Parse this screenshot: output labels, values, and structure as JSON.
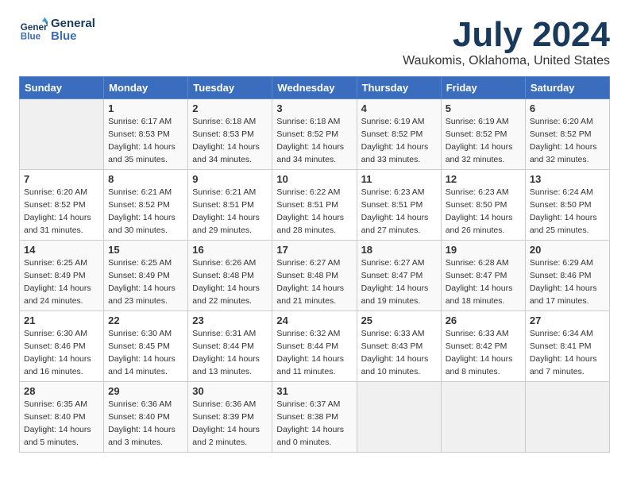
{
  "app": {
    "name": "GeneralBlue",
    "logo_color": "#1a3a5c"
  },
  "header": {
    "month_year": "July 2024",
    "location": "Waukomis, Oklahoma, United States"
  },
  "calendar": {
    "days_of_week": [
      "Sunday",
      "Monday",
      "Tuesday",
      "Wednesday",
      "Thursday",
      "Friday",
      "Saturday"
    ],
    "weeks": [
      [
        {
          "day": "",
          "empty": true
        },
        {
          "day": "1",
          "sunrise": "6:17 AM",
          "sunset": "8:53 PM",
          "daylight": "14 hours and 35 minutes."
        },
        {
          "day": "2",
          "sunrise": "6:18 AM",
          "sunset": "8:53 PM",
          "daylight": "14 hours and 34 minutes."
        },
        {
          "day": "3",
          "sunrise": "6:18 AM",
          "sunset": "8:52 PM",
          "daylight": "14 hours and 34 minutes."
        },
        {
          "day": "4",
          "sunrise": "6:19 AM",
          "sunset": "8:52 PM",
          "daylight": "14 hours and 33 minutes."
        },
        {
          "day": "5",
          "sunrise": "6:19 AM",
          "sunset": "8:52 PM",
          "daylight": "14 hours and 32 minutes."
        },
        {
          "day": "6",
          "sunrise": "6:20 AM",
          "sunset": "8:52 PM",
          "daylight": "14 hours and 32 minutes."
        }
      ],
      [
        {
          "day": "7",
          "sunrise": "6:20 AM",
          "sunset": "8:52 PM",
          "daylight": "14 hours and 31 minutes."
        },
        {
          "day": "8",
          "sunrise": "6:21 AM",
          "sunset": "8:52 PM",
          "daylight": "14 hours and 30 minutes."
        },
        {
          "day": "9",
          "sunrise": "6:21 AM",
          "sunset": "8:51 PM",
          "daylight": "14 hours and 29 minutes."
        },
        {
          "day": "10",
          "sunrise": "6:22 AM",
          "sunset": "8:51 PM",
          "daylight": "14 hours and 28 minutes."
        },
        {
          "day": "11",
          "sunrise": "6:23 AM",
          "sunset": "8:51 PM",
          "daylight": "14 hours and 27 minutes."
        },
        {
          "day": "12",
          "sunrise": "6:23 AM",
          "sunset": "8:50 PM",
          "daylight": "14 hours and 26 minutes."
        },
        {
          "day": "13",
          "sunrise": "6:24 AM",
          "sunset": "8:50 PM",
          "daylight": "14 hours and 25 minutes."
        }
      ],
      [
        {
          "day": "14",
          "sunrise": "6:25 AM",
          "sunset": "8:49 PM",
          "daylight": "14 hours and 24 minutes."
        },
        {
          "day": "15",
          "sunrise": "6:25 AM",
          "sunset": "8:49 PM",
          "daylight": "14 hours and 23 minutes."
        },
        {
          "day": "16",
          "sunrise": "6:26 AM",
          "sunset": "8:48 PM",
          "daylight": "14 hours and 22 minutes."
        },
        {
          "day": "17",
          "sunrise": "6:27 AM",
          "sunset": "8:48 PM",
          "daylight": "14 hours and 21 minutes."
        },
        {
          "day": "18",
          "sunrise": "6:27 AM",
          "sunset": "8:47 PM",
          "daylight": "14 hours and 19 minutes."
        },
        {
          "day": "19",
          "sunrise": "6:28 AM",
          "sunset": "8:47 PM",
          "daylight": "14 hours and 18 minutes."
        },
        {
          "day": "20",
          "sunrise": "6:29 AM",
          "sunset": "8:46 PM",
          "daylight": "14 hours and 17 minutes."
        }
      ],
      [
        {
          "day": "21",
          "sunrise": "6:30 AM",
          "sunset": "8:46 PM",
          "daylight": "14 hours and 16 minutes."
        },
        {
          "day": "22",
          "sunrise": "6:30 AM",
          "sunset": "8:45 PM",
          "daylight": "14 hours and 14 minutes."
        },
        {
          "day": "23",
          "sunrise": "6:31 AM",
          "sunset": "8:44 PM",
          "daylight": "14 hours and 13 minutes."
        },
        {
          "day": "24",
          "sunrise": "6:32 AM",
          "sunset": "8:44 PM",
          "daylight": "14 hours and 11 minutes."
        },
        {
          "day": "25",
          "sunrise": "6:33 AM",
          "sunset": "8:43 PM",
          "daylight": "14 hours and 10 minutes."
        },
        {
          "day": "26",
          "sunrise": "6:33 AM",
          "sunset": "8:42 PM",
          "daylight": "14 hours and 8 minutes."
        },
        {
          "day": "27",
          "sunrise": "6:34 AM",
          "sunset": "8:41 PM",
          "daylight": "14 hours and 7 minutes."
        }
      ],
      [
        {
          "day": "28",
          "sunrise": "6:35 AM",
          "sunset": "8:40 PM",
          "daylight": "14 hours and 5 minutes."
        },
        {
          "day": "29",
          "sunrise": "6:36 AM",
          "sunset": "8:40 PM",
          "daylight": "14 hours and 3 minutes."
        },
        {
          "day": "30",
          "sunrise": "6:36 AM",
          "sunset": "8:39 PM",
          "daylight": "14 hours and 2 minutes."
        },
        {
          "day": "31",
          "sunrise": "6:37 AM",
          "sunset": "8:38 PM",
          "daylight": "14 hours and 0 minutes."
        },
        {
          "day": "",
          "empty": true
        },
        {
          "day": "",
          "empty": true
        },
        {
          "day": "",
          "empty": true
        }
      ]
    ]
  }
}
